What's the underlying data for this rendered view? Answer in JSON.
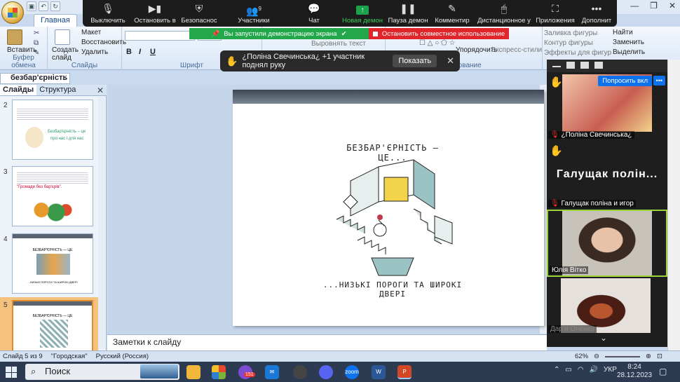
{
  "ppt": {
    "tabs": [
      "Главная",
      "Вста"
    ],
    "clipboard": {
      "paste": "Вставить",
      "group": "Буфер обмена"
    },
    "slides_group": {
      "create_line1": "Создать",
      "create_line2": "слайд",
      "layout": "Макет",
      "reset": "Восстановить",
      "delete": "Удалить",
      "group": "Слайды"
    },
    "font_group": "Шрифт",
    "align_text": "Выровнять текст",
    "drawing": {
      "fill": "Заливка фигуры",
      "outline": "Контур фигуры",
      "effects": "Эффекты для фигур",
      "arrange": "Упорядочить",
      "quick_styles": "Экспресс-стили",
      "group": "Рисование"
    },
    "editing": {
      "find": "Найти",
      "replace": "Заменить",
      "select": "Выделить"
    },
    "doc_tab": "безбар'єрність",
    "pane_tabs": {
      "slides": "Слайды",
      "outline": "Структура"
    },
    "thumbnails": [
      {
        "num": "2",
        "title": "Безбар'єрність – це",
        "subtitle": "про нас і для нас"
      },
      {
        "num": "3",
        "highlight": "\"Громади без бар'єрів\"."
      },
      {
        "num": "4",
        "title": "БЕЗБАР'ЄРНІСТЬ — ЦЕ",
        "caption": "...НИЗЬКІ ПОРОГИ ТА ШИРОКІ ДВЕРІ"
      },
      {
        "num": "5",
        "title": "БЕЗБАР'ЄРНІСТЬ — ЦЕ"
      }
    ],
    "slide": {
      "title": "БЕЗБАР'ЄРНІСТЬ — ЦЕ...",
      "caption": "...НИЗЬКІ ПОРОГИ ТА ШИРОКІ ДВЕРІ"
    },
    "notes_placeholder": "Заметки к слайду",
    "status": {
      "slide": "Слайд 5 из 9",
      "theme": "\"Городская\"",
      "language": "Русский (Россия)",
      "zoom": "62%"
    }
  },
  "zoom": {
    "toolbar": [
      {
        "label": "Выключить",
        "icon": "microphone-icon"
      },
      {
        "label": "Остановить в",
        "icon": "video-icon"
      },
      {
        "label": "Безопаснос",
        "icon": "shield-icon"
      },
      {
        "label": "Участники",
        "icon": "participants-icon",
        "count": "9"
      },
      {
        "label": "Чат",
        "icon": "chat-icon"
      },
      {
        "label": "Новая демон",
        "icon": "share-screen-icon"
      },
      {
        "label": "Пауза демон",
        "icon": "pause-icon"
      },
      {
        "label": "Комментир",
        "icon": "pen-icon"
      },
      {
        "label": "Дистанционное у",
        "icon": "mouse-icon"
      },
      {
        "label": "Приложения",
        "icon": "apps-icon"
      },
      {
        "label": "Дополнит",
        "icon": "more-icon"
      }
    ],
    "sharing_banner": "Вы запустили демонстрацию экрана",
    "stop_share": "Остановить совместное использование",
    "raise_toast": {
      "text": "¿Поліна Свечинська¿ +1 участник поднял руку",
      "button": "Показать"
    },
    "participants": [
      {
        "name": "¿Поліна Свечинська¿",
        "ask_button": "Попросить вкл",
        "more": "•••"
      },
      {
        "name": "Галущак поліна и игор",
        "display": "Галущак полін..."
      },
      {
        "name": "Юлія Вітко"
      },
      {
        "name": "Дарʼя Огієнко"
      }
    ]
  },
  "taskbar": {
    "search_placeholder": "Поиск",
    "viber_badge": "151",
    "zoom_label": "zoom",
    "language": "УКР",
    "time": "8:24",
    "date": "28.12.2023"
  }
}
